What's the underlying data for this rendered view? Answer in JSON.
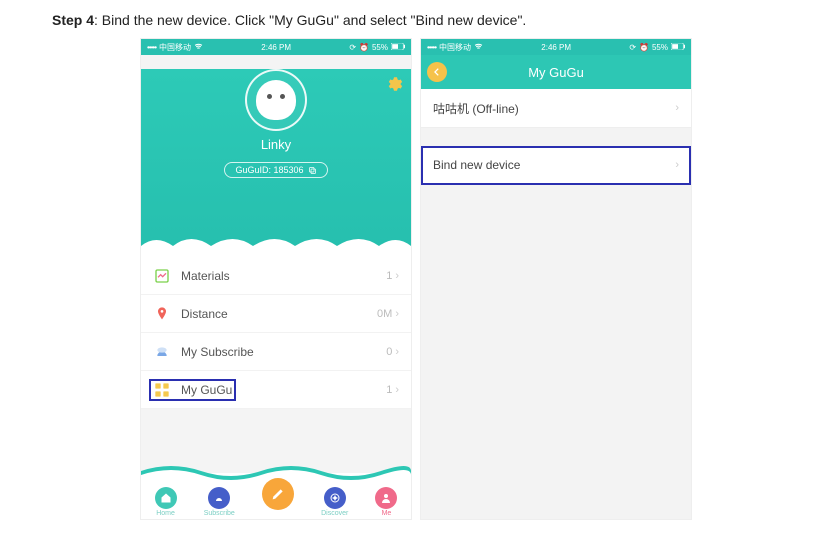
{
  "instruction": {
    "step_label": "Step 4",
    "text": ": Bind the new device. Click \"My GuGu\" and select \"Bind new device\"."
  },
  "statusbar": {
    "carrier": "中国移动",
    "time": "2:46 PM",
    "battery": "55%"
  },
  "phone1": {
    "username": "Linky",
    "id_label": "GuGuID: 185306",
    "items": [
      {
        "label": "Materials",
        "value": "1"
      },
      {
        "label": "Distance",
        "value": "0M"
      },
      {
        "label": "My Subscribe",
        "value": "0"
      },
      {
        "label": "My GuGu",
        "value": "1"
      }
    ],
    "tabs": [
      "Home",
      "Subscribe",
      "",
      "Discover",
      "Me"
    ]
  },
  "phone2": {
    "title": "My GuGu",
    "items": [
      {
        "label": "咕咕机  (Off-line)"
      },
      {
        "label": "Bind new device"
      }
    ]
  }
}
